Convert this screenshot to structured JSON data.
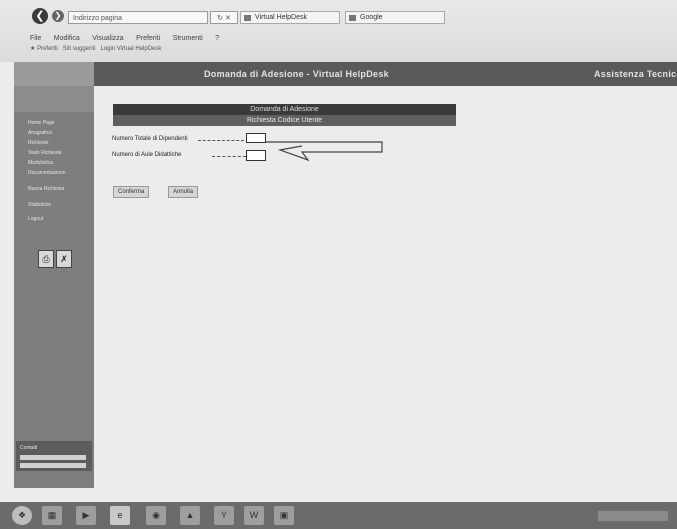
{
  "browser": {
    "back_icon": "back-arrow-icon",
    "address_text": "Indirizzo pagina",
    "tabs": [
      "Virtual HelpDesk",
      "Google"
    ],
    "menu": [
      "File",
      "Modifica",
      "Visualizza",
      "Preferiti",
      "Strumenti",
      "?"
    ],
    "favorites": [
      "Preferiti",
      "Siti suggeriti",
      "Login Virtual HelpDesk"
    ]
  },
  "banner": {
    "title": "Domanda di Adesione - Virtual HelpDesk",
    "right": "Assistenza Tecnica"
  },
  "sidebar": {
    "items": [
      "Home Page",
      "Anagrafica",
      "Richieste",
      "Stato Richieste",
      "Modulistica",
      "Documentazione",
      "Nuova Richiesta",
      "Statistiche",
      "Logout"
    ],
    "footer": "Contatti"
  },
  "form": {
    "header1": "Domanda di Adesione",
    "header2": "Richiesta Codice Utente",
    "field1_label": "Numero Totale di Dipendenti",
    "field2_label": "Numero di Aule Didattiche",
    "field1_value": "",
    "field2_value": ""
  },
  "buttons": {
    "confirm": "Conferma",
    "cancel": "Annulla"
  }
}
